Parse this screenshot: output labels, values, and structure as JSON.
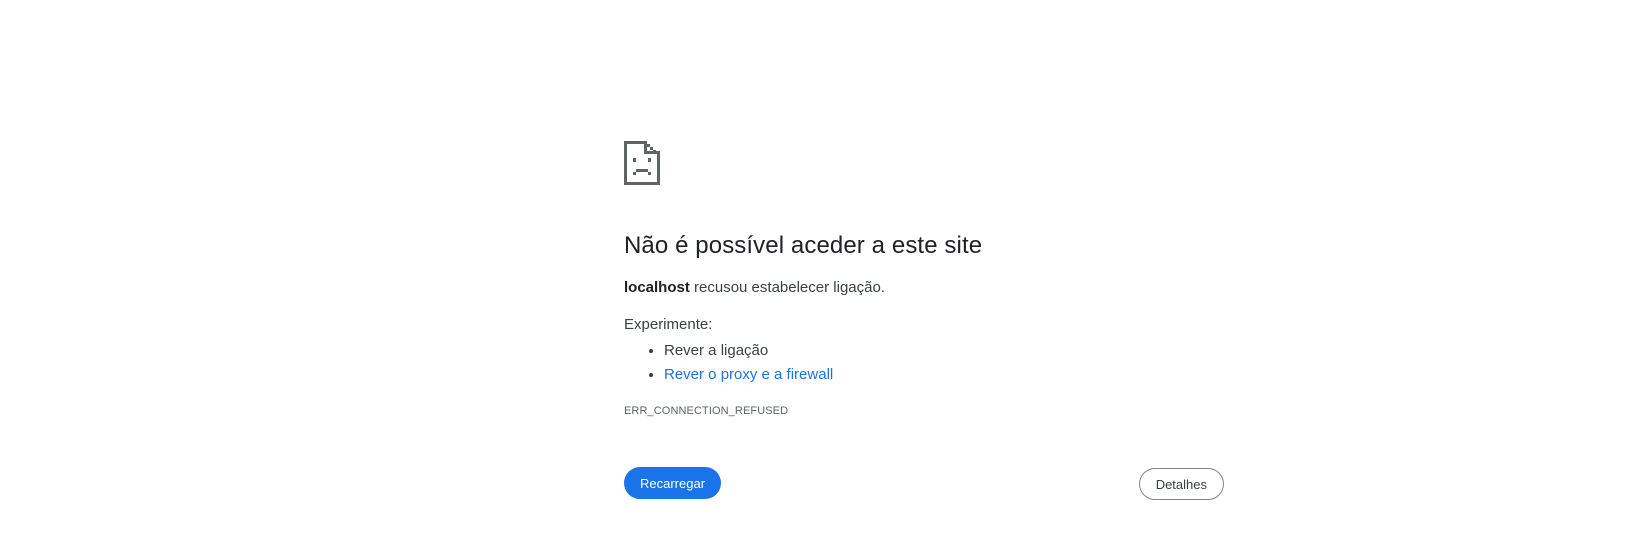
{
  "error_page": {
    "icon": "sad-page-icon",
    "title": "Não é possível aceder a este site",
    "summary": {
      "host": "localhost",
      "message": " recusou estabelecer ligação."
    },
    "suggestions_heading": "Experimente:",
    "suggestions": [
      {
        "label": "Rever a ligação",
        "link": false
      },
      {
        "label": "Rever o proxy e a firewall",
        "link": true
      }
    ],
    "error_code": "ERR_CONNECTION_REFUSED",
    "buttons": {
      "reload_label": "Recarregar",
      "details_label": "Detalhes"
    }
  },
  "colors": {
    "accent": "#1a73e8",
    "text": "#202124",
    "secondary_text": "#3c4043",
    "link": "#1a73e8"
  }
}
